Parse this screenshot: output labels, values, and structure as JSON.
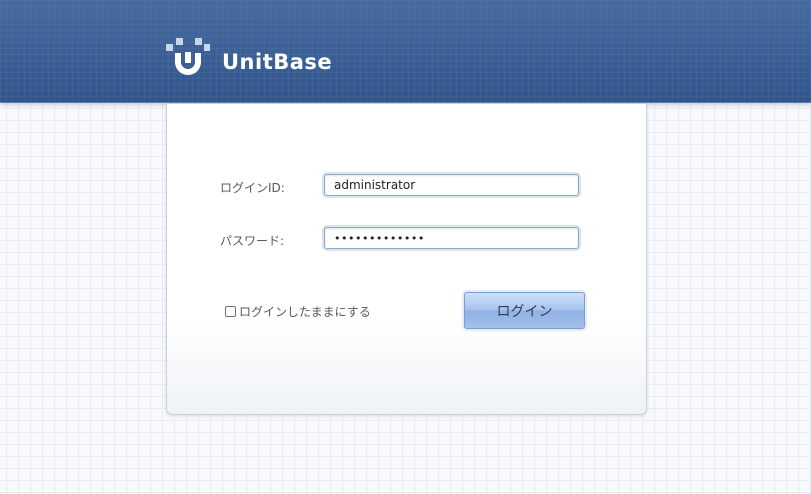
{
  "header": {
    "brand": "UnitBase",
    "background_color": "#2f558c"
  },
  "login_form": {
    "login_id_label": "ログインID:",
    "login_id_value": "administrator",
    "password_label": "パスワード:",
    "password_value": "•••••••••••••",
    "remember_label": "ログインしたままにする",
    "remember_checked": false,
    "submit_label": "ログイン"
  },
  "colors": {
    "button_gradient_top": "#cfe0f7",
    "button_gradient_bottom": "#8fb1e3",
    "field_border": "#8fa7c5",
    "label_text": "#555a60"
  },
  "icons": {
    "logo": "unitbase-logo-icon",
    "checkbox": "checkbox-icon"
  }
}
